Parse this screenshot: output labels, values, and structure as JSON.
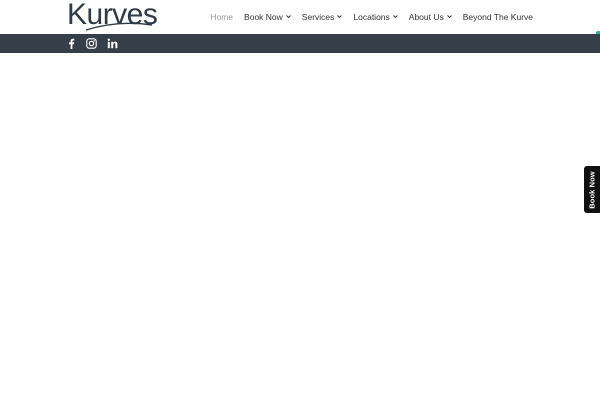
{
  "header": {
    "logo_text": "Kurves",
    "nav": {
      "home": "Home",
      "book_now": "Book Now",
      "services": "Services",
      "locations": "Locations",
      "about_us": "About Us",
      "beyond": "Beyond The Kurve"
    }
  },
  "social": {
    "icons": [
      "facebook-icon",
      "instagram-icon",
      "linkedin-icon"
    ]
  },
  "side_tab": {
    "label": "Book Now"
  },
  "colors": {
    "brand_dark": "#363e49",
    "logo": "#2f3a47",
    "nav_text": "#333333",
    "nav_active": "#9a9a9a",
    "accent_teal": "#2bb3a3",
    "side_tab_bg": "#111111"
  }
}
